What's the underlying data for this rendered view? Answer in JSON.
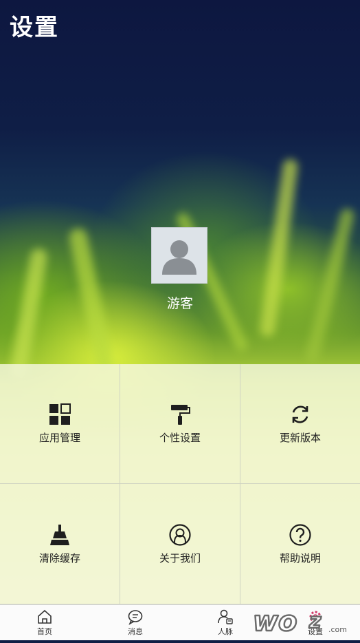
{
  "header": {
    "title": "设置"
  },
  "profile": {
    "name": "游客"
  },
  "grid": [
    {
      "label": "应用管理",
      "icon": "apps-grid-icon"
    },
    {
      "label": "个性设置",
      "icon": "paint-roller-icon"
    },
    {
      "label": "更新版本",
      "icon": "refresh-icon"
    },
    {
      "label": "清除缓存",
      "icon": "broom-icon"
    },
    {
      "label": "关于我们",
      "icon": "about-us-icon"
    },
    {
      "label": "帮助说明",
      "icon": "help-icon"
    }
  ],
  "tabs": [
    {
      "label": "首页",
      "icon": "home-icon"
    },
    {
      "label": "消息",
      "icon": "message-icon"
    },
    {
      "label": "人脉",
      "icon": "contacts-icon"
    },
    {
      "label": "设置",
      "icon": "settings-icon",
      "active": true
    }
  ],
  "watermark": {
    "text": "wo.z.com"
  },
  "colors": {
    "text_dark": "#222222",
    "header_text": "#ffffff"
  }
}
